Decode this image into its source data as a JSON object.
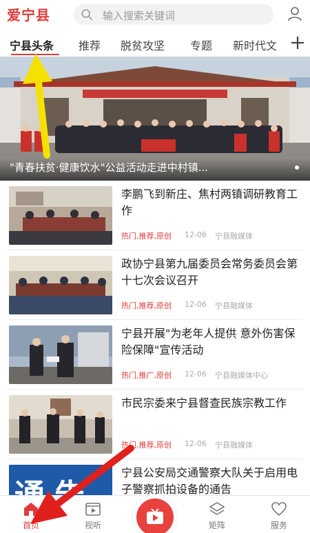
{
  "app": {
    "logo_text": "爱宁县"
  },
  "search": {
    "placeholder": "输入搜索关键词"
  },
  "tabs": [
    {
      "label": "宁县头条",
      "active": true
    },
    {
      "label": "推荐"
    },
    {
      "label": "脱贫攻坚"
    },
    {
      "label": "专题"
    },
    {
      "label": "新时代文"
    }
  ],
  "banner": {
    "caption": "\"青春扶贫·健康饮水\"公益活动走进中村镇...",
    "image_desc": "group-photo"
  },
  "news": [
    {
      "title": "李鹏飞到新庄、焦村两镇调研教育工作",
      "tags": "热门,推荐,原创",
      "date": "12-06",
      "source": "宁县融媒体"
    },
    {
      "title": "政协宁县第九届委员会常务委员会第十七次会议召开",
      "tags": "热门,推荐,原创",
      "date": "12-06",
      "source": "宁县融媒体"
    },
    {
      "title": "宁县开展\"为老年人提供 意外伤害保险保障\"宣传活动",
      "tags": "热门,推广,原创",
      "date": "12-06",
      "source": "宁县融媒体中心"
    },
    {
      "title": "市民宗委来宁县督查民族宗教工作",
      "tags": "热门,推荐,原创",
      "date": "12-06",
      "source": "宁县融媒体"
    },
    {
      "title": "宁县公安局交通警察大队关于启用电子警察抓拍设备的通告",
      "tags": "",
      "date": "",
      "source": "",
      "thumb_text": "通告"
    }
  ],
  "bottom_nav": [
    {
      "label": "首页",
      "icon": "home-icon",
      "active": true
    },
    {
      "label": "视听",
      "icon": "video-icon"
    },
    {
      "label": "矩阵",
      "icon": "matrix-icon"
    },
    {
      "label": "服务",
      "icon": "heart-icon"
    }
  ],
  "colors": {
    "accent": "#e33b3b",
    "annotation_yellow": "#f5e100",
    "annotation_red": "#e0201c"
  }
}
